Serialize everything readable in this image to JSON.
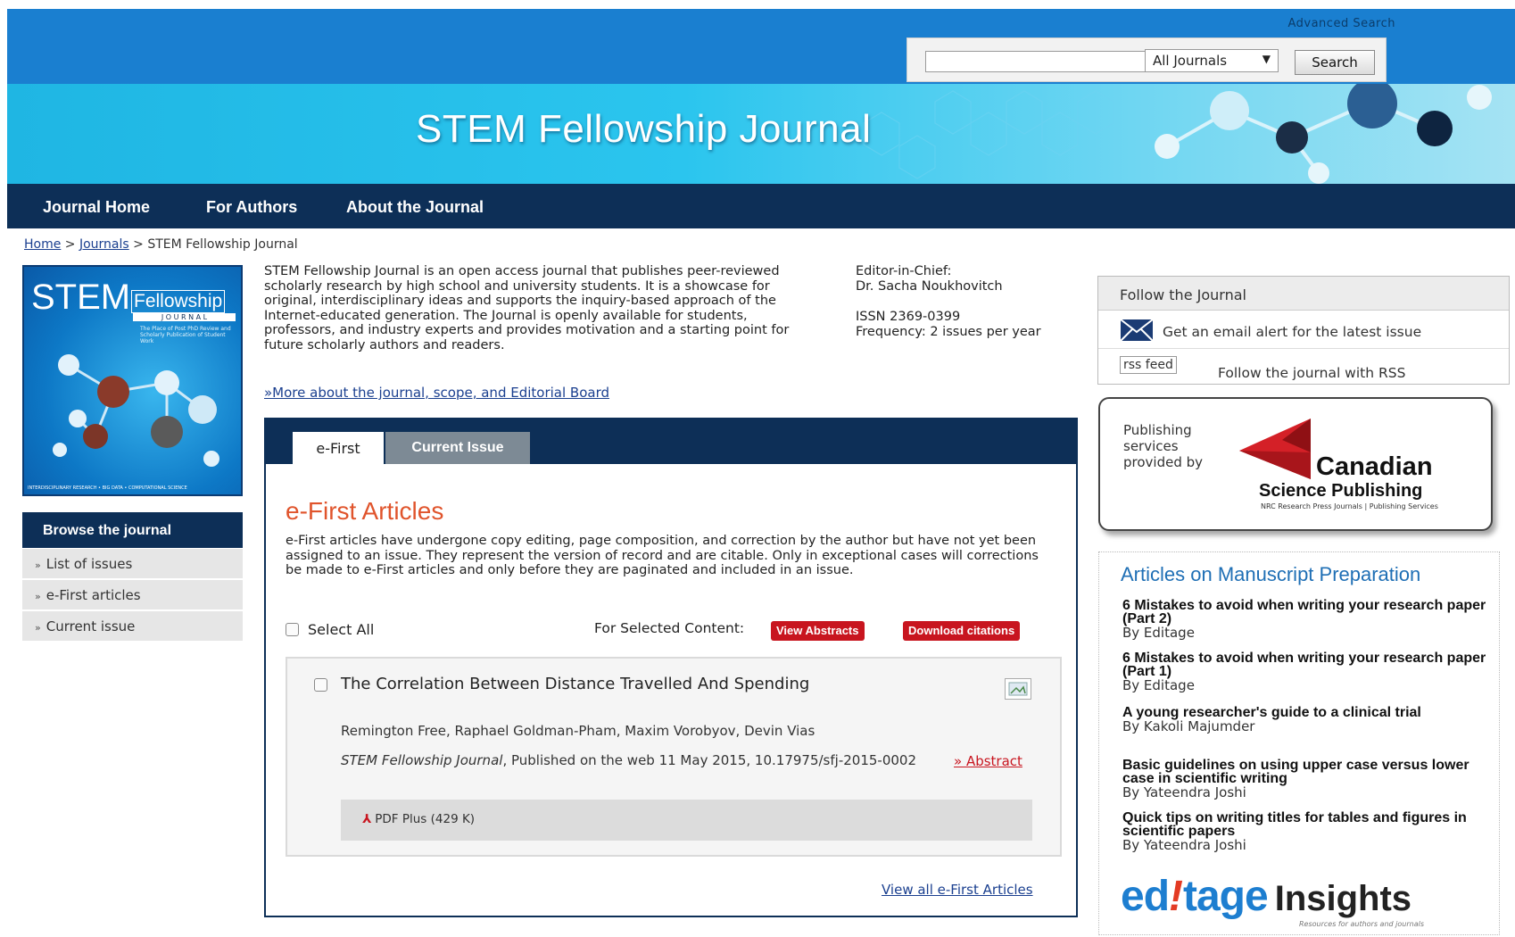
{
  "header": {
    "advanced_search": "Advanced Search",
    "search_input_value": "",
    "journal_select_value": "All Journals",
    "search_button": "Search",
    "banner_title": "STEM Fellowship Journal"
  },
  "nav": {
    "items": [
      {
        "label": "Journal Home"
      },
      {
        "label": "For Authors"
      },
      {
        "label": "About the Journal"
      }
    ]
  },
  "breadcrumb": {
    "home": "Home",
    "sep1": " > ",
    "journals": "Journals",
    "sep2": " > ",
    "current": "STEM Fellowship Journal"
  },
  "cover": {
    "stem": "STEM",
    "fellowship": "Fellowship",
    "journal": "J O U R N A L",
    "tagline": "The Place of Post PhD Review and Scholarly Publication of Student Work",
    "footer": "INTERDISCIPLINARY RESEARCH • BIG DATA • COMPUTATIONAL SCIENCE"
  },
  "browse": {
    "title": "Browse the journal",
    "items": [
      {
        "label": "List of issues"
      },
      {
        "label": "e-First articles"
      },
      {
        "label": "Current issue"
      }
    ]
  },
  "intro": {
    "text": "STEM Fellowship Journal is an open access journal that publishes peer-reviewed scholarly research by high school and university students. It is a showcase for original, interdisciplinary ideas and supports the inquiry-based approach of the Internet-educated generation. The Journal is openly available for students, professors, and industry experts and provides motivation and a starting point for future scholarly authors and readers.",
    "more_link": "»More about the journal, scope, and Editorial Board"
  },
  "editor": {
    "label": "Editor-in-Chief:",
    "name": "Dr. Sacha Noukhovitch",
    "issn": "ISSN 2369-0399",
    "frequency": "Frequency: 2 issues per year"
  },
  "tabs": {
    "efirst": "e-First",
    "current": "Current Issue"
  },
  "efirst": {
    "title": "e-First Articles",
    "description": "e-First articles have undergone copy editing, page composition, and correction by the author but have not yet been assigned to an issue. They represent the version of record and are citable. Only in exceptional cases will corrections be made to e-First articles and only before they are paginated and included in an issue.",
    "select_all": "Select All",
    "for_selected": "For Selected Content:",
    "view_abstracts": "View Abstracts",
    "download_citations": "Download citations",
    "view_all": "View all e-First Articles"
  },
  "article": {
    "title": "The Correlation Between Distance Travelled And Spending",
    "authors": "Remington Free, Raphael Goldman-Pham, Maxim Vorobyov, Devin Vias",
    "journal": "STEM Fellowship Journal",
    "citation_rest": ", Published on the web 11 May 2015, 10.17975/sfj-2015-0002",
    "abstract_link": "» Abstract",
    "pdf_label": "PDF Plus (429 K)"
  },
  "follow": {
    "title": "Follow the Journal",
    "email_alert": "Get an email alert for the latest issue",
    "rss_alt": "rss feed",
    "rss_label": "Follow the journal with RSS"
  },
  "publisher": {
    "label": "Publishing services provided by",
    "name": "Canadian",
    "subname": "Science Publishing",
    "tagline": "NRC Research Press Journals | Publishing Services",
    "logo_color": "#d42027"
  },
  "manuscript": {
    "title": "Articles on Manuscript Preparation",
    "items": [
      {
        "title": "6 Mistakes to avoid when writing your research paper (Part 2)",
        "by": "By Editage"
      },
      {
        "title": "6 Mistakes to avoid when writing your research paper (Part 1)",
        "by": "By Editage"
      },
      {
        "title": "A young researcher's guide to a clinical trial",
        "by": "By Kakoli Majumder"
      },
      {
        "title": "Basic guidelines on using upper case versus lower case in scientific writing",
        "by": "By Yateendra Joshi"
      },
      {
        "title": "Quick tips on writing titles for tables and figures in scientific papers",
        "by": "By Yateendra Joshi"
      }
    ],
    "logo_ed": "ed",
    "logo_bang": "!",
    "logo_tage": "tage",
    "logo_insights": "Insights",
    "logo_sub": "Resources for authors and journals"
  },
  "colors": {
    "nav_bg": "#0d2f57",
    "header_blue": "#1a7fd0",
    "accent_orange": "#e0542c",
    "button_red": "#c8151f",
    "link_blue": "#1f6fb5"
  }
}
